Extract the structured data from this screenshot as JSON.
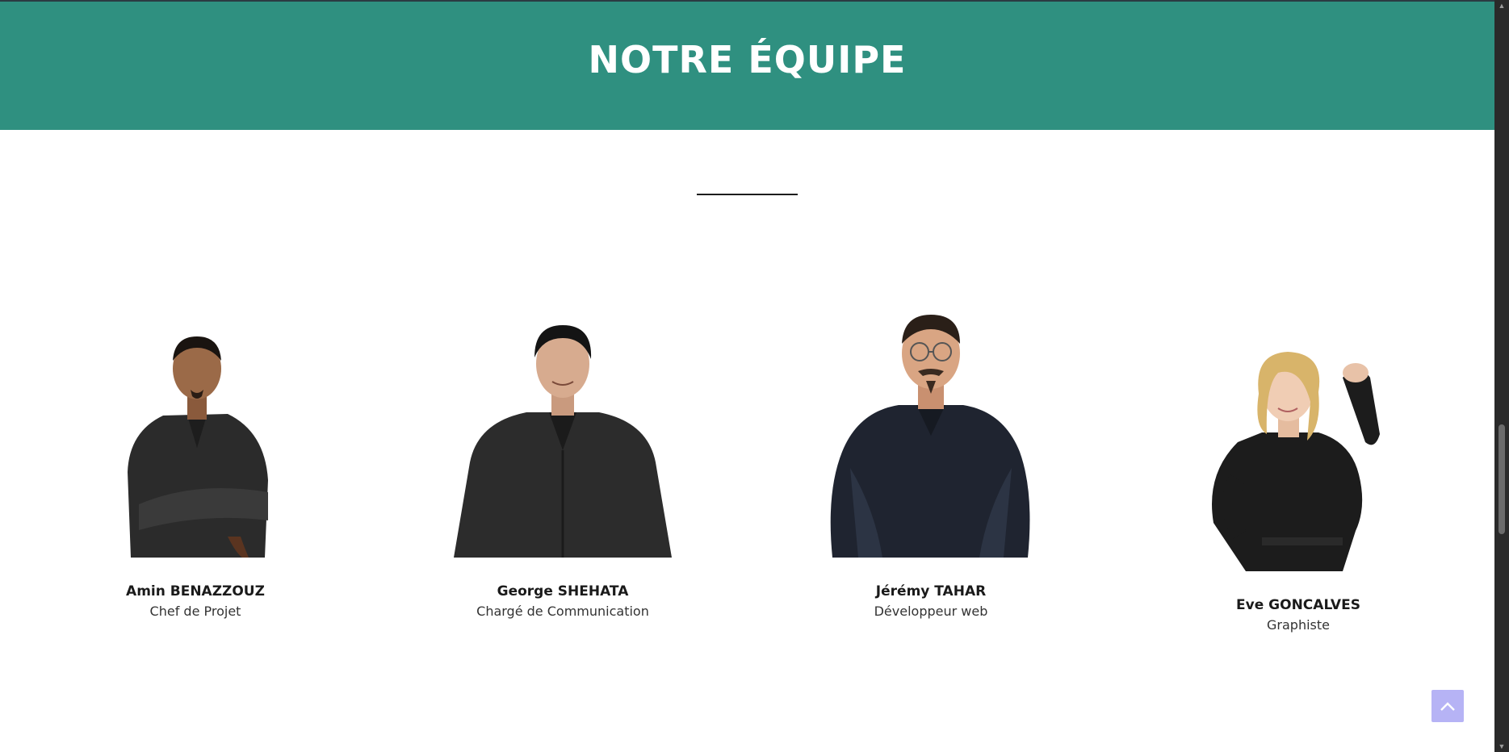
{
  "section": {
    "title": "NOTRE ÉQUIPE"
  },
  "colors": {
    "banner": "#2f9080",
    "back_to_top": "#b6b3f5",
    "scrollbar": "#2a2a2a"
  },
  "team": [
    {
      "name": "Amin BENAZZOUZ",
      "role": "Chef de Projet",
      "avatar": "avatar-male-arms-crossed"
    },
    {
      "name": "George SHEHATA",
      "role": "Chargé de Communication",
      "avatar": "avatar-male-standing"
    },
    {
      "name": "Jérémy TAHAR",
      "role": "Développeur web",
      "avatar": "avatar-male-glasses-hands-on-hips"
    },
    {
      "name": "Eve GONCALVES",
      "role": "Graphiste",
      "avatar": "avatar-female-waving"
    }
  ],
  "back_to_top": {
    "icon": "chevron-up-icon"
  },
  "scrollbar": {
    "up_icon": "scroll-up-arrow-icon",
    "down_icon": "scroll-down-arrow-icon"
  }
}
